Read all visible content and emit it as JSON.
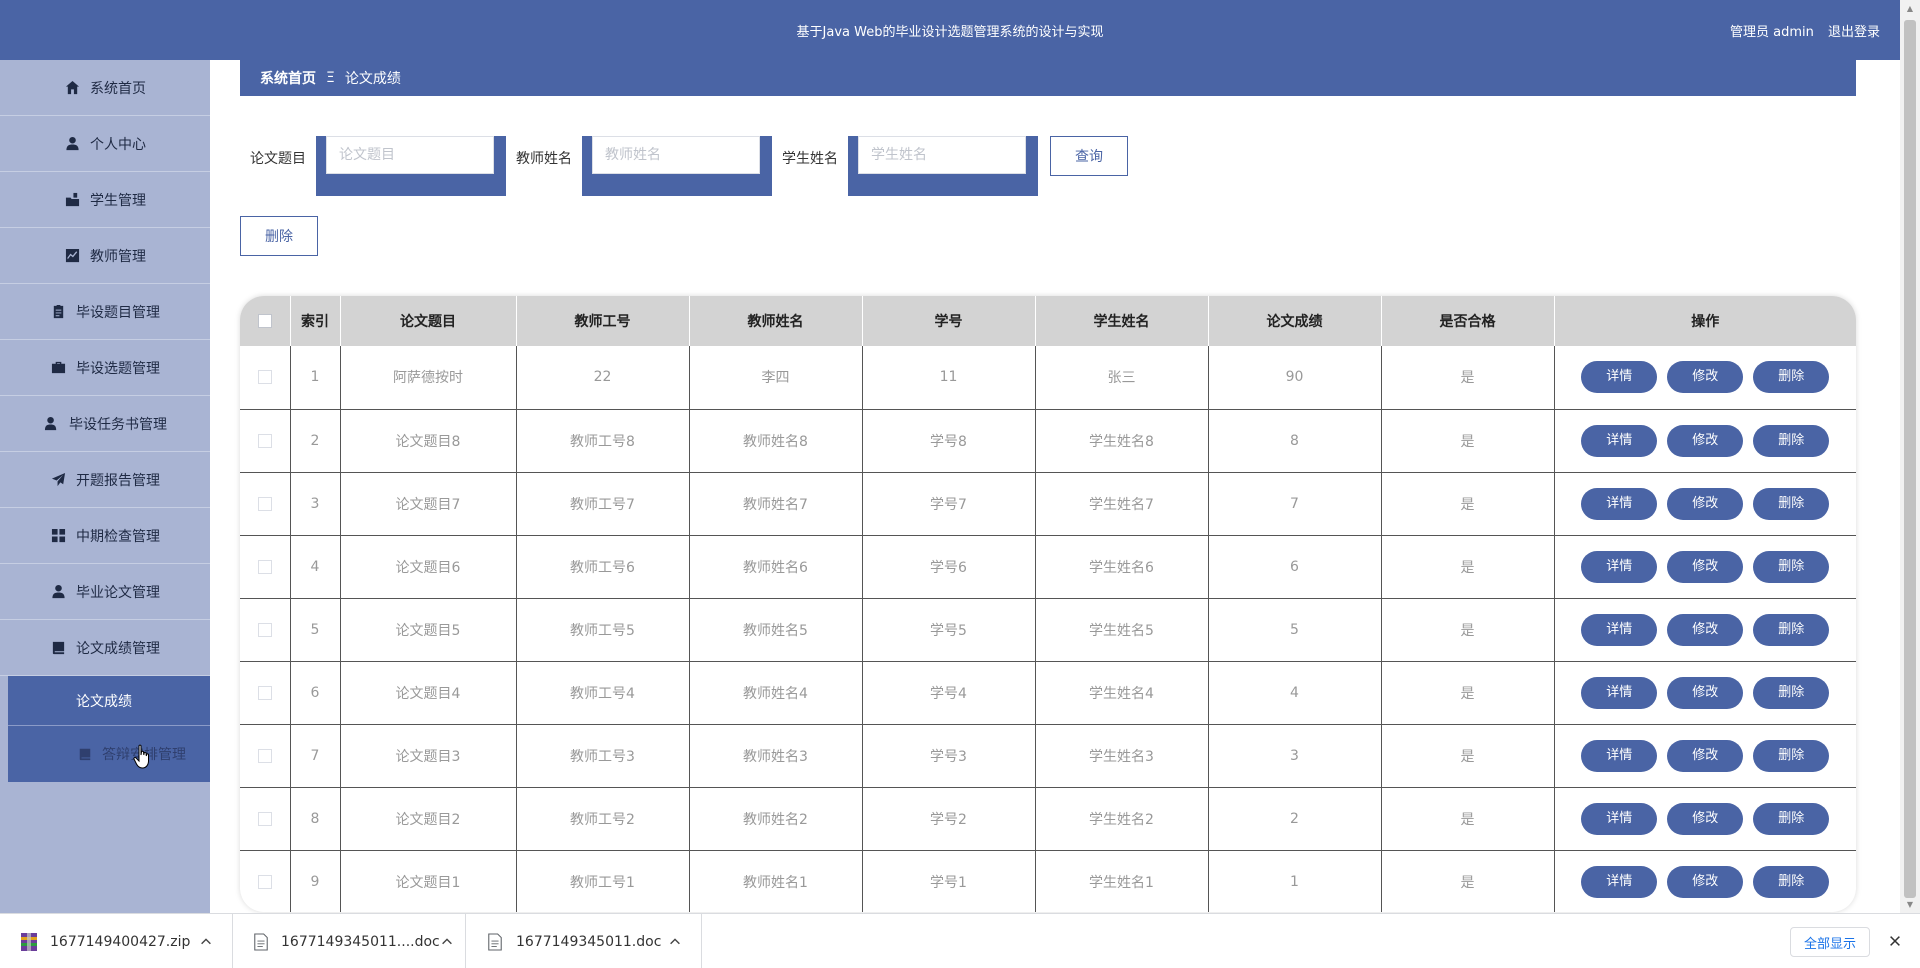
{
  "header": {
    "title": "基于Java Web的毕业设计选题管理系统的设计与实现",
    "user_label": "管理员 admin",
    "logout_label": "退出登录"
  },
  "sidebar": {
    "items": [
      {
        "label": "系统首页",
        "icon": "home-icon"
      },
      {
        "label": "个人中心",
        "icon": "user-icon"
      },
      {
        "label": "学生管理",
        "icon": "folder-icon"
      },
      {
        "label": "教师管理",
        "icon": "chart-icon"
      },
      {
        "label": "毕设题目管理",
        "icon": "clipboard-icon"
      },
      {
        "label": "毕设选题管理",
        "icon": "briefcase-icon"
      },
      {
        "label": "毕设任务书管理",
        "icon": "person-icon"
      },
      {
        "label": "开题报告管理",
        "icon": "send-icon"
      },
      {
        "label": "中期检查管理",
        "icon": "grid-icon"
      },
      {
        "label": "毕业论文管理",
        "icon": "user-icon"
      },
      {
        "label": "论文成绩管理",
        "icon": "book-icon"
      }
    ],
    "active_sub": "论文成绩",
    "next_item_label": "答辩安排管理"
  },
  "breadcrumb": {
    "home": "系统首页",
    "separator": "Ξ",
    "current": "论文成绩"
  },
  "search": {
    "fields": [
      {
        "label": "论文题目",
        "placeholder": "论文题目"
      },
      {
        "label": "教师姓名",
        "placeholder": "教师姓名"
      },
      {
        "label": "学生姓名",
        "placeholder": "学生姓名"
      }
    ],
    "query_label": "查询",
    "delete_label": "删除"
  },
  "table": {
    "headers": [
      "索引",
      "论文题目",
      "教师工号",
      "教师姓名",
      "学号",
      "学生姓名",
      "论文成绩",
      "是否合格",
      "操作"
    ],
    "rows": [
      [
        "1",
        "阿萨德按时",
        "22",
        "李四",
        "11",
        "张三",
        "90",
        "是"
      ],
      [
        "2",
        "论文题目8",
        "教师工号8",
        "教师姓名8",
        "学号8",
        "学生姓名8",
        "8",
        "是"
      ],
      [
        "3",
        "论文题目7",
        "教师工号7",
        "教师姓名7",
        "学号7",
        "学生姓名7",
        "7",
        "是"
      ],
      [
        "4",
        "论文题目6",
        "教师工号6",
        "教师姓名6",
        "学号6",
        "学生姓名6",
        "6",
        "是"
      ],
      [
        "5",
        "论文题目5",
        "教师工号5",
        "教师姓名5",
        "学号5",
        "学生姓名5",
        "5",
        "是"
      ],
      [
        "6",
        "论文题目4",
        "教师工号4",
        "教师姓名4",
        "学号4",
        "学生姓名4",
        "4",
        "是"
      ],
      [
        "7",
        "论文题目3",
        "教师工号3",
        "教师姓名3",
        "学号3",
        "学生姓名3",
        "3",
        "是"
      ],
      [
        "8",
        "论文题目2",
        "教师工号2",
        "教师姓名2",
        "学号2",
        "学生姓名2",
        "2",
        "是"
      ],
      [
        "9",
        "论文题目1",
        "教师工号1",
        "教师姓名1",
        "学号1",
        "学生姓名1",
        "1",
        "是"
      ]
    ],
    "actions": [
      "详情",
      "修改",
      "删除"
    ]
  },
  "downloads": {
    "items": [
      {
        "name": "1677149400427.zip",
        "icon": "zip-file-icon"
      },
      {
        "name": "1677149345011....doc",
        "icon": "doc-file-icon"
      },
      {
        "name": "1677149345011.doc",
        "icon": "doc-file-icon"
      }
    ],
    "show_all_label": "全部显示"
  },
  "colors": {
    "primary": "#4a64a5",
    "sidebar": "#a9b4d3",
    "header_row": "#d3d3d3"
  }
}
